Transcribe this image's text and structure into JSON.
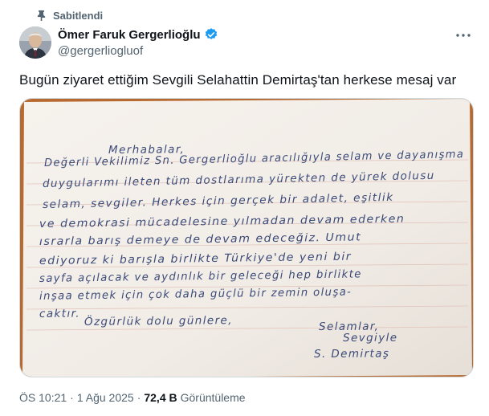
{
  "pinned": {
    "label": "Sabitlendi",
    "icon": "pin-icon"
  },
  "author": {
    "display_name": "Ömer Faruk Gergerlioğlu",
    "handle": "@gergerliogluof",
    "verified_icon": "verified-badge-icon",
    "verified_color": "#1d9bf0"
  },
  "more_icon": "more-options-icon",
  "tweet": {
    "text": "Bugün ziyaret ettiğim Sevgili Selahattin Demirtaş'tan herkese mesaj var"
  },
  "letter": {
    "lines": [
      "Merhabalar,",
      "Değerli Vekilimiz Sn. Gergerlioğlu aracılığıyla selam ve dayanışma",
      "duygularımı ileten tüm dostlarıma yürekten de yürek dolusu",
      "selam, sevgiler. Herkes için gerçek bir adalet, eşitlik",
      "ve demokrasi mücadelesine yılmadan devam ederken",
      "ısrarla barış demeye de devam edeceğiz. Umut",
      "ediyoruz ki barışla birlikte Türkiye'de yeni bir",
      "sayfa açılacak ve aydınlık bir geleceği hep birlikte",
      "inşaa etmek için çok daha güçlü bir zemin oluşa-",
      "caktır.",
      "Özgürlük dolu günlere,",
      "Selamlar,",
      "Sevgiyle",
      "S. Demirtaş"
    ]
  },
  "meta": {
    "time": "ÖS 10:21",
    "separator": "·",
    "date": "1 Ağu 2025",
    "views_count": "72,4 B",
    "views_label": "Görüntüleme"
  },
  "colors": {
    "text_primary": "#0f1419",
    "text_secondary": "#536471",
    "ink": "#3b4a78",
    "paper": "#f3eee9"
  }
}
